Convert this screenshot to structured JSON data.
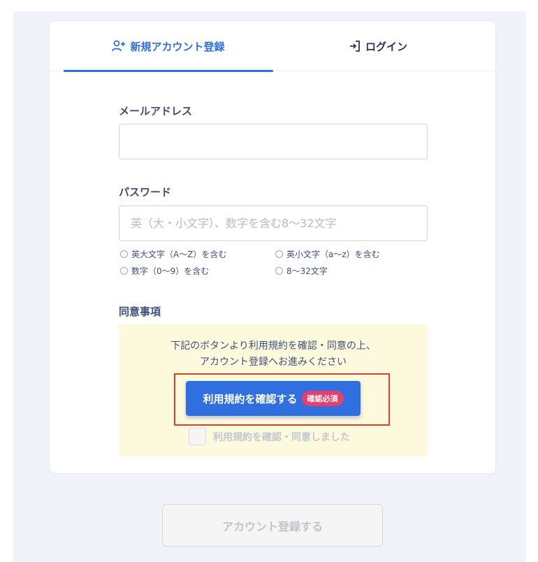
{
  "tabs": {
    "register_label": "新規アカウント登録",
    "login_label": "ログイン"
  },
  "email": {
    "label": "メールアドレス",
    "value": "",
    "placeholder": ""
  },
  "password": {
    "label": "パスワード",
    "value": "",
    "placeholder": "英（大・小文字）、数字を含む8〜32文字",
    "rules": [
      "英大文字（A〜Z）を含む",
      "英小文字（a〜z）を含む",
      "数字（0〜9）を含む",
      "8〜32文字"
    ]
  },
  "consent": {
    "label": "同意事項",
    "line1": "下記のボタンより利用規約を確認・同意の上、",
    "line2": "アカウント登録へお進みください",
    "terms_button": "利用規約を確認する",
    "required_badge": "確認必須",
    "checkbox_label": "利用規約を確認・同意しました",
    "checked": false
  },
  "submit_label": "アカウント登録する",
  "colors": {
    "accent": "#2f6fe0",
    "badge": "#e83e6c",
    "highlight_border": "#e0402a",
    "consent_bg": "#fdf9dc",
    "page_bg": "#f1f3fb"
  },
  "icons": {
    "register_tab": "user-plus-icon",
    "login_tab": "sign-in-icon",
    "rule_status": "circle-outline-icon"
  }
}
